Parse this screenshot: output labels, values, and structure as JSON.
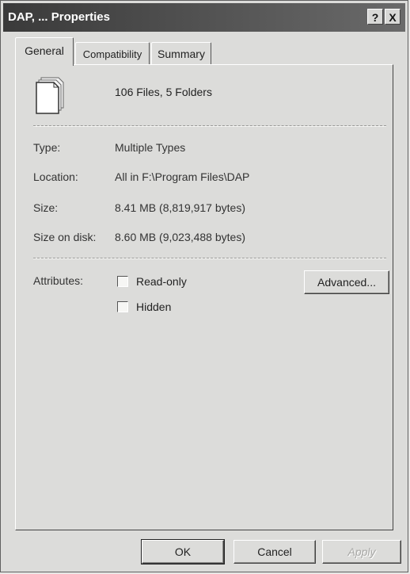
{
  "window": {
    "title": "DAP, ... Properties",
    "help_label": "?",
    "close_label": "X"
  },
  "tabs": [
    {
      "label": "General",
      "active": true
    },
    {
      "label": "Compatibility",
      "active": false
    },
    {
      "label": "Summary",
      "active": false
    }
  ],
  "general": {
    "icon": "file-stack-icon",
    "summary": "106 Files, 5 Folders",
    "properties": [
      {
        "label": "Type:",
        "value": "Multiple Types"
      },
      {
        "label": "Location:",
        "value": "All in F:\\Program Files\\DAP"
      },
      {
        "label": "Size:",
        "value": "8.41 MB (8,819,917 bytes)"
      },
      {
        "label": "Size on disk:",
        "value": "8.60 MB (9,023,488 bytes)"
      }
    ],
    "attributes_label": "Attributes:",
    "attributes": [
      {
        "label": "Read-only",
        "checked": false
      },
      {
        "label": "Hidden",
        "checked": false
      }
    ],
    "advanced_label": "Advanced..."
  },
  "footer": {
    "ok_label": "OK",
    "cancel_label": "Cancel",
    "apply_label": "Apply"
  }
}
